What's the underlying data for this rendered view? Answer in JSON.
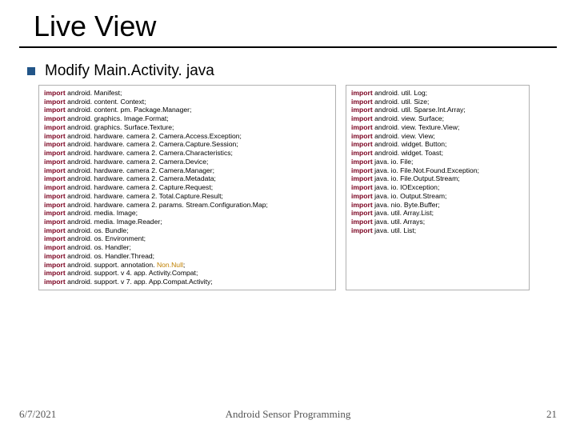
{
  "title": "Live View",
  "subtitle": "Modify Main.Activity. java",
  "left_imports": [
    "android. Manifest;",
    "android. content. Context;",
    "android. content. pm. Package.Manager;",
    "android. graphics. Image.Format;",
    "android. graphics. Surface.Texture;",
    "android. hardware. camera 2. Camera.Access.Exception;",
    "android. hardware. camera 2. Camera.Capture.Session;",
    "android. hardware. camera 2. Camera.Characteristics;",
    "android. hardware. camera 2. Camera.Device;",
    "android. hardware. camera 2. Camera.Manager;",
    "android. hardware. camera 2. Camera.Metadata;",
    "android. hardware. camera 2. Capture.Request;",
    "android. hardware. camera 2. Total.Capture.Result;",
    "android. hardware. camera 2. params. Stream.Configuration.Map;",
    "android. media. Image;",
    "android. media. Image.Reader;",
    "android. os. Bundle;",
    "android. os. Environment;",
    "android. os. Handler;",
    "android. os. Handler.Thread;",
    [
      "android. support. annotation. ",
      "Non.Null",
      ";"
    ],
    "android. support. v 4. app. Activity.Compat;",
    "android. support. v 7. app. App.Compat.Activity;"
  ],
  "right_imports": [
    "android. util. Log;",
    "android. util. Size;",
    "android. util. Sparse.Int.Array;",
    "android. view. Surface;",
    "android. view. Texture.View;",
    "android. view. View;",
    "android. widget. Button;",
    "android. widget. Toast;",
    "java. io. File;",
    "java. io. File.Not.Found.Exception;",
    "java. io. File.Output.Stream;",
    "java. io. IOException;",
    "java. io. Output.Stream;",
    "java. nio. Byte.Buffer;",
    "java. util. Array.List;",
    "java. util. Arrays;",
    "java. util. List;"
  ],
  "footer": {
    "date": "6/7/2021",
    "center": "Android Sensor Programming",
    "page": "21"
  }
}
